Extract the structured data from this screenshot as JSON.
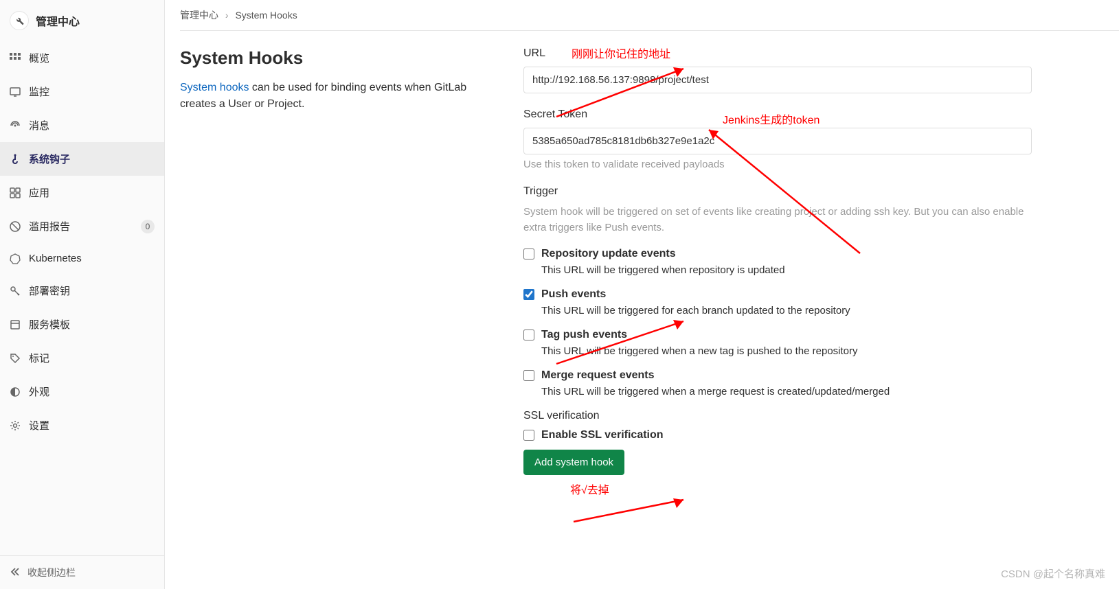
{
  "sidebar": {
    "title": "管理中心",
    "items": [
      {
        "label": "概览",
        "icon": "dashboard"
      },
      {
        "label": "监控",
        "icon": "monitor"
      },
      {
        "label": "消息",
        "icon": "broadcast"
      },
      {
        "label": "系统钩子",
        "icon": "hook"
      },
      {
        "label": "应用",
        "icon": "apps"
      },
      {
        "label": "滥用报告",
        "icon": "report",
        "badge": "0"
      },
      {
        "label": "Kubernetes",
        "icon": "kube"
      },
      {
        "label": "部署密钥",
        "icon": "key"
      },
      {
        "label": "服务模板",
        "icon": "template"
      },
      {
        "label": "标记",
        "icon": "tag"
      },
      {
        "label": "外观",
        "icon": "appearance"
      },
      {
        "label": "设置",
        "icon": "settings"
      }
    ],
    "active_index": 3,
    "collapse_label": "收起侧边栏"
  },
  "breadcrumb": {
    "root": "管理中心",
    "current": "System Hooks"
  },
  "page": {
    "heading": "System Hooks",
    "desc_link": "System hooks",
    "desc_rest": " can be used for binding events when GitLab creates a User or Project."
  },
  "form": {
    "url_label": "URL",
    "url_value": "http://192.168.56.137:9898/project/test",
    "token_label": "Secret Token",
    "token_value": "5385a650ad785c8181db6b327e9e1a2c",
    "token_help": "Use this token to validate received payloads",
    "trigger_label": "Trigger",
    "trigger_desc": "System hook will be triggered on set of events like creating project or adding ssh key. But you can also enable extra triggers like Push events.",
    "checkboxes": [
      {
        "label": "Repository update events",
        "desc": "This URL will be triggered when repository is updated",
        "checked": false
      },
      {
        "label": "Push events",
        "desc": "This URL will be triggered for each branch updated to the repository",
        "checked": true
      },
      {
        "label": "Tag push events",
        "desc": "This URL will be triggered when a new tag is pushed to the repository",
        "checked": false
      },
      {
        "label": "Merge request events",
        "desc": "This URL will be triggered when a merge request is created/updated/merged",
        "checked": false
      }
    ],
    "ssl_label": "SSL verification",
    "ssl_checkbox_label": "Enable SSL verification",
    "ssl_checked": false,
    "submit_label": "Add system hook"
  },
  "annotations": {
    "url": "刚刚让你记住的地址",
    "token": "Jenkins生成的token",
    "ssl": "将√去掉"
  },
  "watermark": "CSDN @起个名称真难"
}
